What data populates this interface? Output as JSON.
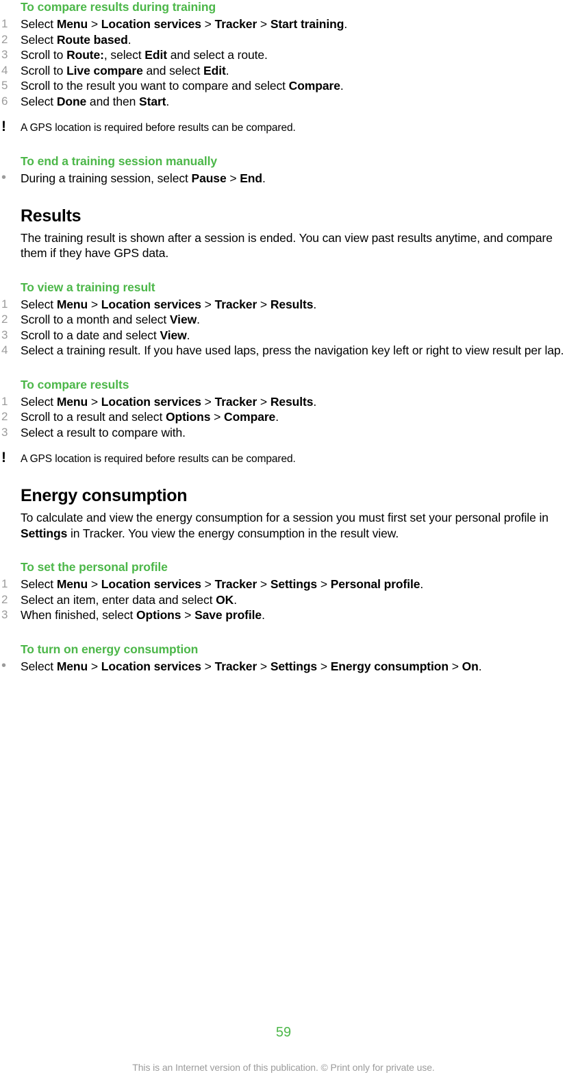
{
  "page": {
    "number": "59",
    "footer_note": "This is an Internet version of this publication. © Print only for private use.",
    "accent_color": "#4cb749",
    "marker_color": "#9b9b9b",
    "text_color": "#000000"
  },
  "icons": {
    "note": "!",
    "bullet": "•"
  },
  "blocks": {
    "task1": {
      "heading": "To compare results during training",
      "steps": [
        {
          "marker": "1",
          "parts": [
            {
              "t": "Select ",
              "b": false
            },
            {
              "t": "Menu",
              "b": true
            },
            {
              "t": " > ",
              "b": false
            },
            {
              "t": "Location services",
              "b": true
            },
            {
              "t": " > ",
              "b": false
            },
            {
              "t": "Tracker",
              "b": true
            },
            {
              "t": " > ",
              "b": false
            },
            {
              "t": "Start training",
              "b": true
            },
            {
              "t": ".",
              "b": false
            }
          ]
        },
        {
          "marker": "2",
          "parts": [
            {
              "t": "Select ",
              "b": false
            },
            {
              "t": "Route based",
              "b": true
            },
            {
              "t": ".",
              "b": false
            }
          ]
        },
        {
          "marker": "3",
          "parts": [
            {
              "t": "Scroll to ",
              "b": false
            },
            {
              "t": "Route:",
              "b": true
            },
            {
              "t": ", select ",
              "b": false
            },
            {
              "t": "Edit",
              "b": true
            },
            {
              "t": " and select a route.",
              "b": false
            }
          ]
        },
        {
          "marker": "4",
          "parts": [
            {
              "t": "Scroll to ",
              "b": false
            },
            {
              "t": "Live compare",
              "b": true
            },
            {
              "t": " and select ",
              "b": false
            },
            {
              "t": "Edit",
              "b": true
            },
            {
              "t": ".",
              "b": false
            }
          ]
        },
        {
          "marker": "5",
          "parts": [
            {
              "t": "Scroll to the result you want to compare and select ",
              "b": false
            },
            {
              "t": "Compare",
              "b": true
            },
            {
              "t": ".",
              "b": false
            }
          ]
        },
        {
          "marker": "6",
          "parts": [
            {
              "t": "Select ",
              "b": false
            },
            {
              "t": "Done",
              "b": true
            },
            {
              "t": " and then ",
              "b": false
            },
            {
              "t": "Start",
              "b": true
            },
            {
              "t": ".",
              "b": false
            }
          ]
        }
      ]
    },
    "note1": {
      "text": "A GPS location is required before results can be compared."
    },
    "task2": {
      "heading": "To end a training session manually",
      "steps": [
        {
          "marker": "•",
          "bulleted": true,
          "parts": [
            {
              "t": "During a training session, select ",
              "b": false
            },
            {
              "t": "Pause",
              "b": true
            },
            {
              "t": " > ",
              "b": false
            },
            {
              "t": "End",
              "b": true
            },
            {
              "t": ".",
              "b": false
            }
          ]
        }
      ]
    },
    "section_results": {
      "heading": "Results",
      "paragraph": "The training result is shown after a session is ended. You can view past results anytime, and compare them if they have GPS data."
    },
    "task3": {
      "heading": "To view a training result",
      "steps": [
        {
          "marker": "1",
          "parts": [
            {
              "t": "Select ",
              "b": false
            },
            {
              "t": "Menu",
              "b": true
            },
            {
              "t": " > ",
              "b": false
            },
            {
              "t": "Location services",
              "b": true
            },
            {
              "t": " > ",
              "b": false
            },
            {
              "t": "Tracker",
              "b": true
            },
            {
              "t": " > ",
              "b": false
            },
            {
              "t": "Results",
              "b": true
            },
            {
              "t": ".",
              "b": false
            }
          ]
        },
        {
          "marker": "2",
          "parts": [
            {
              "t": "Scroll to a month and select ",
              "b": false
            },
            {
              "t": "View",
              "b": true
            },
            {
              "t": ".",
              "b": false
            }
          ]
        },
        {
          "marker": "3",
          "parts": [
            {
              "t": "Scroll to a date and select ",
              "b": false
            },
            {
              "t": "View",
              "b": true
            },
            {
              "t": ".",
              "b": false
            }
          ]
        },
        {
          "marker": "4",
          "parts": [
            {
              "t": "Select a training result. If you have used laps, press the navigation key left or right to view result per lap.",
              "b": false
            }
          ]
        }
      ]
    },
    "task4": {
      "heading": "To compare results",
      "steps": [
        {
          "marker": "1",
          "parts": [
            {
              "t": "Select ",
              "b": false
            },
            {
              "t": "Menu",
              "b": true
            },
            {
              "t": " > ",
              "b": false
            },
            {
              "t": "Location services",
              "b": true
            },
            {
              "t": " > ",
              "b": false
            },
            {
              "t": "Tracker",
              "b": true
            },
            {
              "t": " > ",
              "b": false
            },
            {
              "t": "Results",
              "b": true
            },
            {
              "t": ".",
              "b": false
            }
          ]
        },
        {
          "marker": "2",
          "parts": [
            {
              "t": "Scroll to a result and select ",
              "b": false
            },
            {
              "t": "Options",
              "b": true
            },
            {
              "t": " > ",
              "b": false
            },
            {
              "t": "Compare",
              "b": true
            },
            {
              "t": ".",
              "b": false
            }
          ]
        },
        {
          "marker": "3",
          "parts": [
            {
              "t": "Select a result to compare with.",
              "b": false
            }
          ]
        }
      ]
    },
    "note2": {
      "text": "A GPS location is required before results can be compared."
    },
    "section_energy": {
      "heading": "Energy consumption",
      "paragraph_parts": [
        {
          "t": "To calculate and view the energy consumption for a session you must first set your personal profile in ",
          "b": false
        },
        {
          "t": "Settings",
          "b": true
        },
        {
          "t": " in Tracker. You view the energy consumption in the result view.",
          "b": false
        }
      ]
    },
    "task5": {
      "heading": "To set the personal profile",
      "steps": [
        {
          "marker": "1",
          "parts": [
            {
              "t": "Select ",
              "b": false
            },
            {
              "t": "Menu",
              "b": true
            },
            {
              "t": " > ",
              "b": false
            },
            {
              "t": "Location services",
              "b": true
            },
            {
              "t": " > ",
              "b": false
            },
            {
              "t": "Tracker",
              "b": true
            },
            {
              "t": " > ",
              "b": false
            },
            {
              "t": "Settings",
              "b": true
            },
            {
              "t": " > ",
              "b": false
            },
            {
              "t": "Personal profile",
              "b": true
            },
            {
              "t": ".",
              "b": false
            }
          ]
        },
        {
          "marker": "2",
          "parts": [
            {
              "t": "Select an item, enter data and select ",
              "b": false
            },
            {
              "t": "OK",
              "b": true
            },
            {
              "t": ".",
              "b": false
            }
          ]
        },
        {
          "marker": "3",
          "parts": [
            {
              "t": "When finished, select ",
              "b": false
            },
            {
              "t": "Options",
              "b": true
            },
            {
              "t": " > ",
              "b": false
            },
            {
              "t": "Save profile",
              "b": true
            },
            {
              "t": ".",
              "b": false
            }
          ]
        }
      ]
    },
    "task6": {
      "heading": "To turn on energy consumption",
      "steps": [
        {
          "marker": "•",
          "bulleted": true,
          "parts": [
            {
              "t": "Select ",
              "b": false
            },
            {
              "t": "Menu",
              "b": true
            },
            {
              "t": " > ",
              "b": false
            },
            {
              "t": "Location services",
              "b": true
            },
            {
              "t": " > ",
              "b": false
            },
            {
              "t": "Tracker",
              "b": true
            },
            {
              "t": " > ",
              "b": false
            },
            {
              "t": "Settings",
              "b": true
            },
            {
              "t": " > ",
              "b": false
            },
            {
              "t": "Energy consumption",
              "b": true
            },
            {
              "t": " > ",
              "b": false
            },
            {
              "t": "On",
              "b": true
            },
            {
              "t": ".",
              "b": false
            }
          ]
        }
      ]
    }
  }
}
